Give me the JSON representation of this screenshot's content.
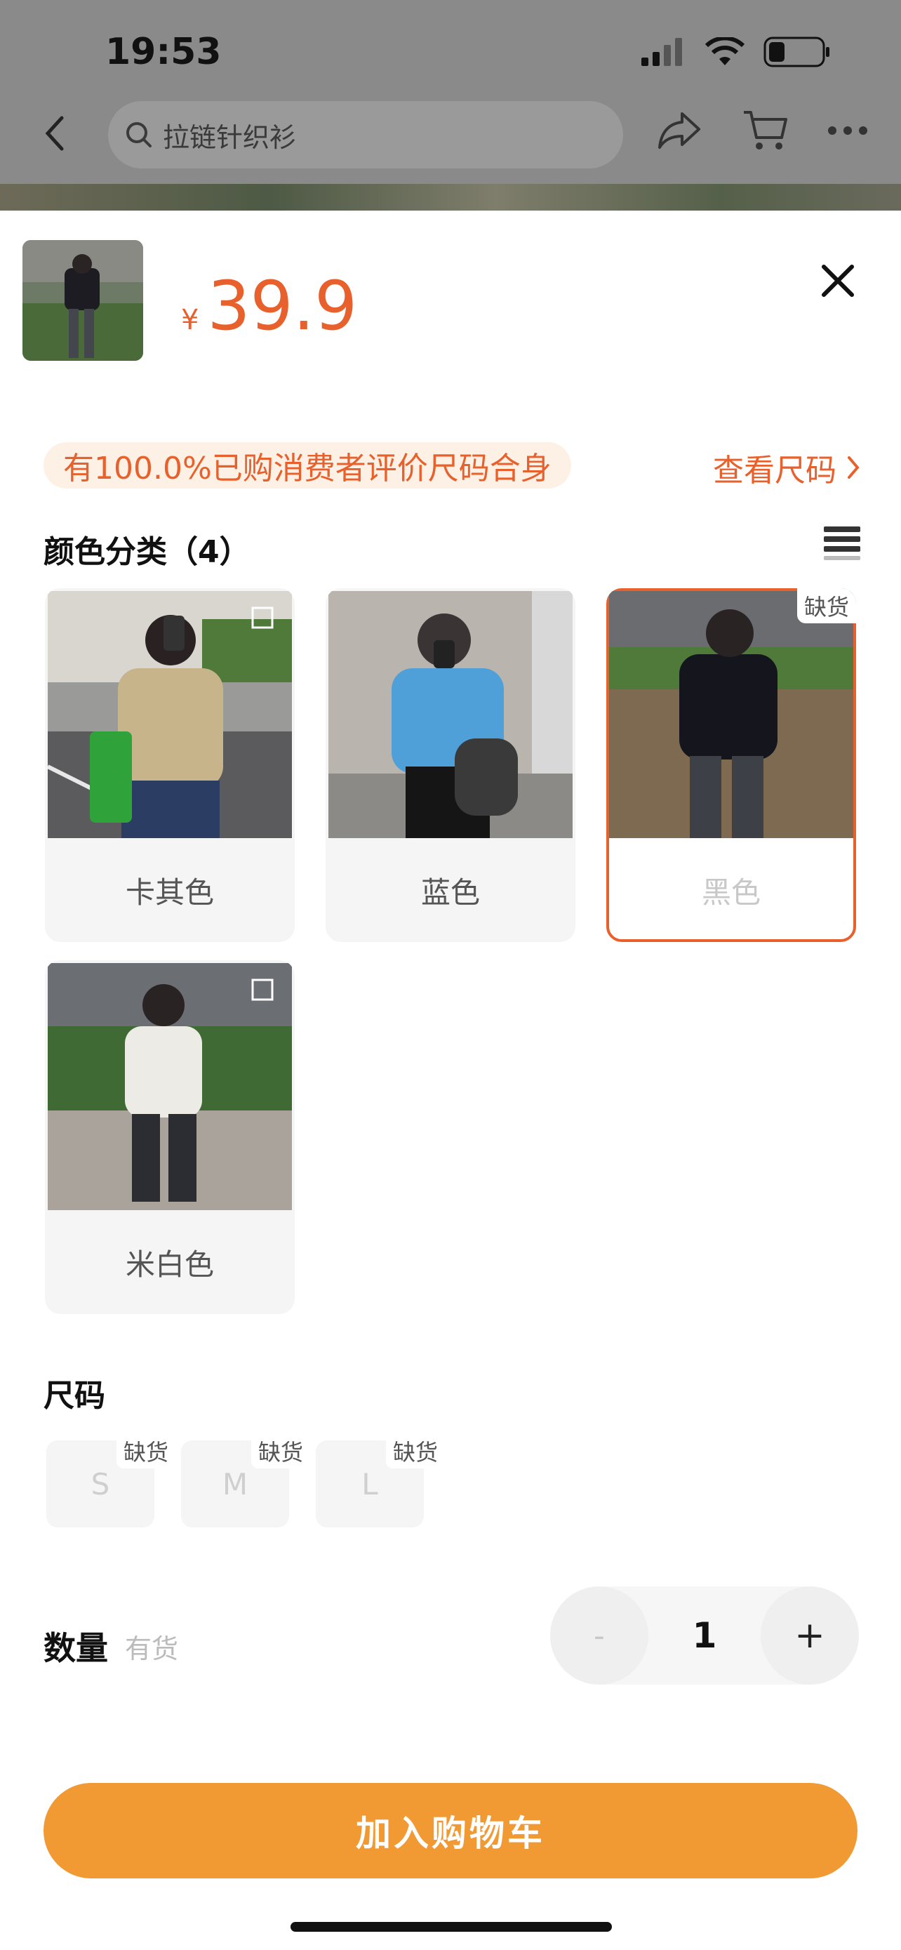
{
  "status_bar": {
    "time": "19:53"
  },
  "nav": {
    "search_text": "拉链针织衫"
  },
  "product": {
    "currency": "¥",
    "price": "39.9"
  },
  "fit": {
    "badge": "有100.0%已购消费者评价尺码合身",
    "size_guide": "查看尺码"
  },
  "colors": {
    "title": "颜色分类（4）",
    "out_of_stock": "缺货",
    "items": [
      {
        "label": "卡其色",
        "selected": false
      },
      {
        "label": "蓝色",
        "selected": false
      },
      {
        "label": "黑色",
        "selected": true
      },
      {
        "label": "米白色",
        "selected": false
      }
    ]
  },
  "sizes": {
    "title": "尺码",
    "items": [
      {
        "label": "S",
        "tag": "缺货"
      },
      {
        "label": "M",
        "tag": "缺货"
      },
      {
        "label": "L",
        "tag": "缺货"
      }
    ]
  },
  "quantity": {
    "label": "数量",
    "stock": "有货",
    "minus": "-",
    "value": "1",
    "plus": "+"
  },
  "cart": {
    "button": "加入购物车"
  },
  "accent": "#e8612c",
  "button_color": "#f19a33"
}
